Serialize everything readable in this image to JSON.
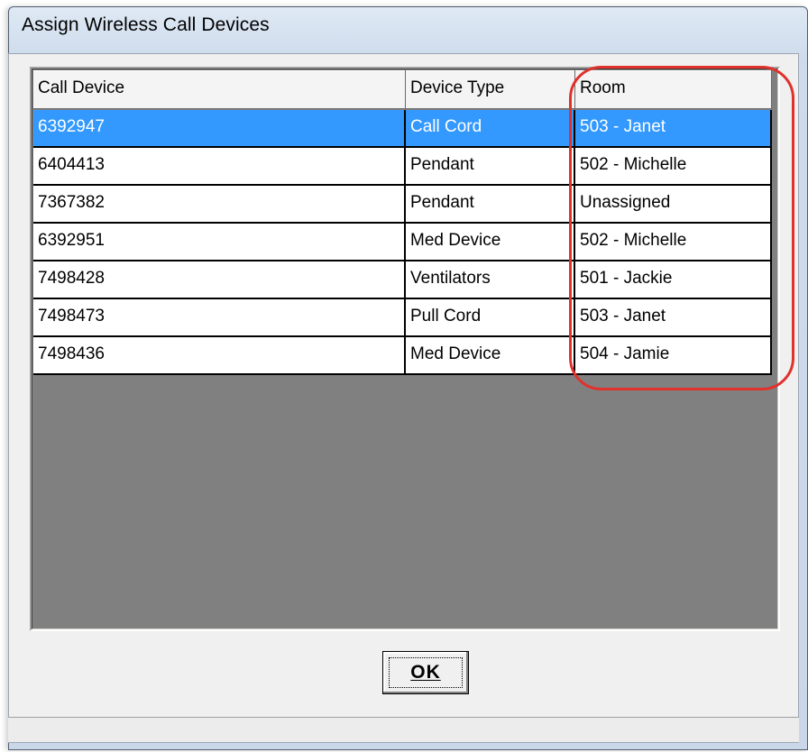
{
  "window": {
    "title": "Assign Wireless Call Devices"
  },
  "table": {
    "headers": [
      "Call Device",
      "Device Type",
      "Room"
    ],
    "rows": [
      [
        "6392947",
        "Call Cord",
        "503 - Janet"
      ],
      [
        "6404413",
        "Pendant",
        "502 - Michelle"
      ],
      [
        "7367382",
        "Pendant",
        "Unassigned"
      ],
      [
        "6392951",
        "Med Device",
        "502 - Michelle"
      ],
      [
        "7498428",
        "Ventilators",
        "501 - Jackie"
      ],
      [
        "7498473",
        "Pull Cord",
        "503 - Janet"
      ],
      [
        "7498436",
        "Med Device",
        "504 - Jamie"
      ]
    ],
    "selected_row": 0,
    "selection_color": "#3399ff",
    "empty_area_color": "#808080"
  },
  "annotation": {
    "color": "#e0312d",
    "highlights_column": "Room"
  },
  "buttons": {
    "ok_label": "OK",
    "ok_mnemonic": "O"
  }
}
